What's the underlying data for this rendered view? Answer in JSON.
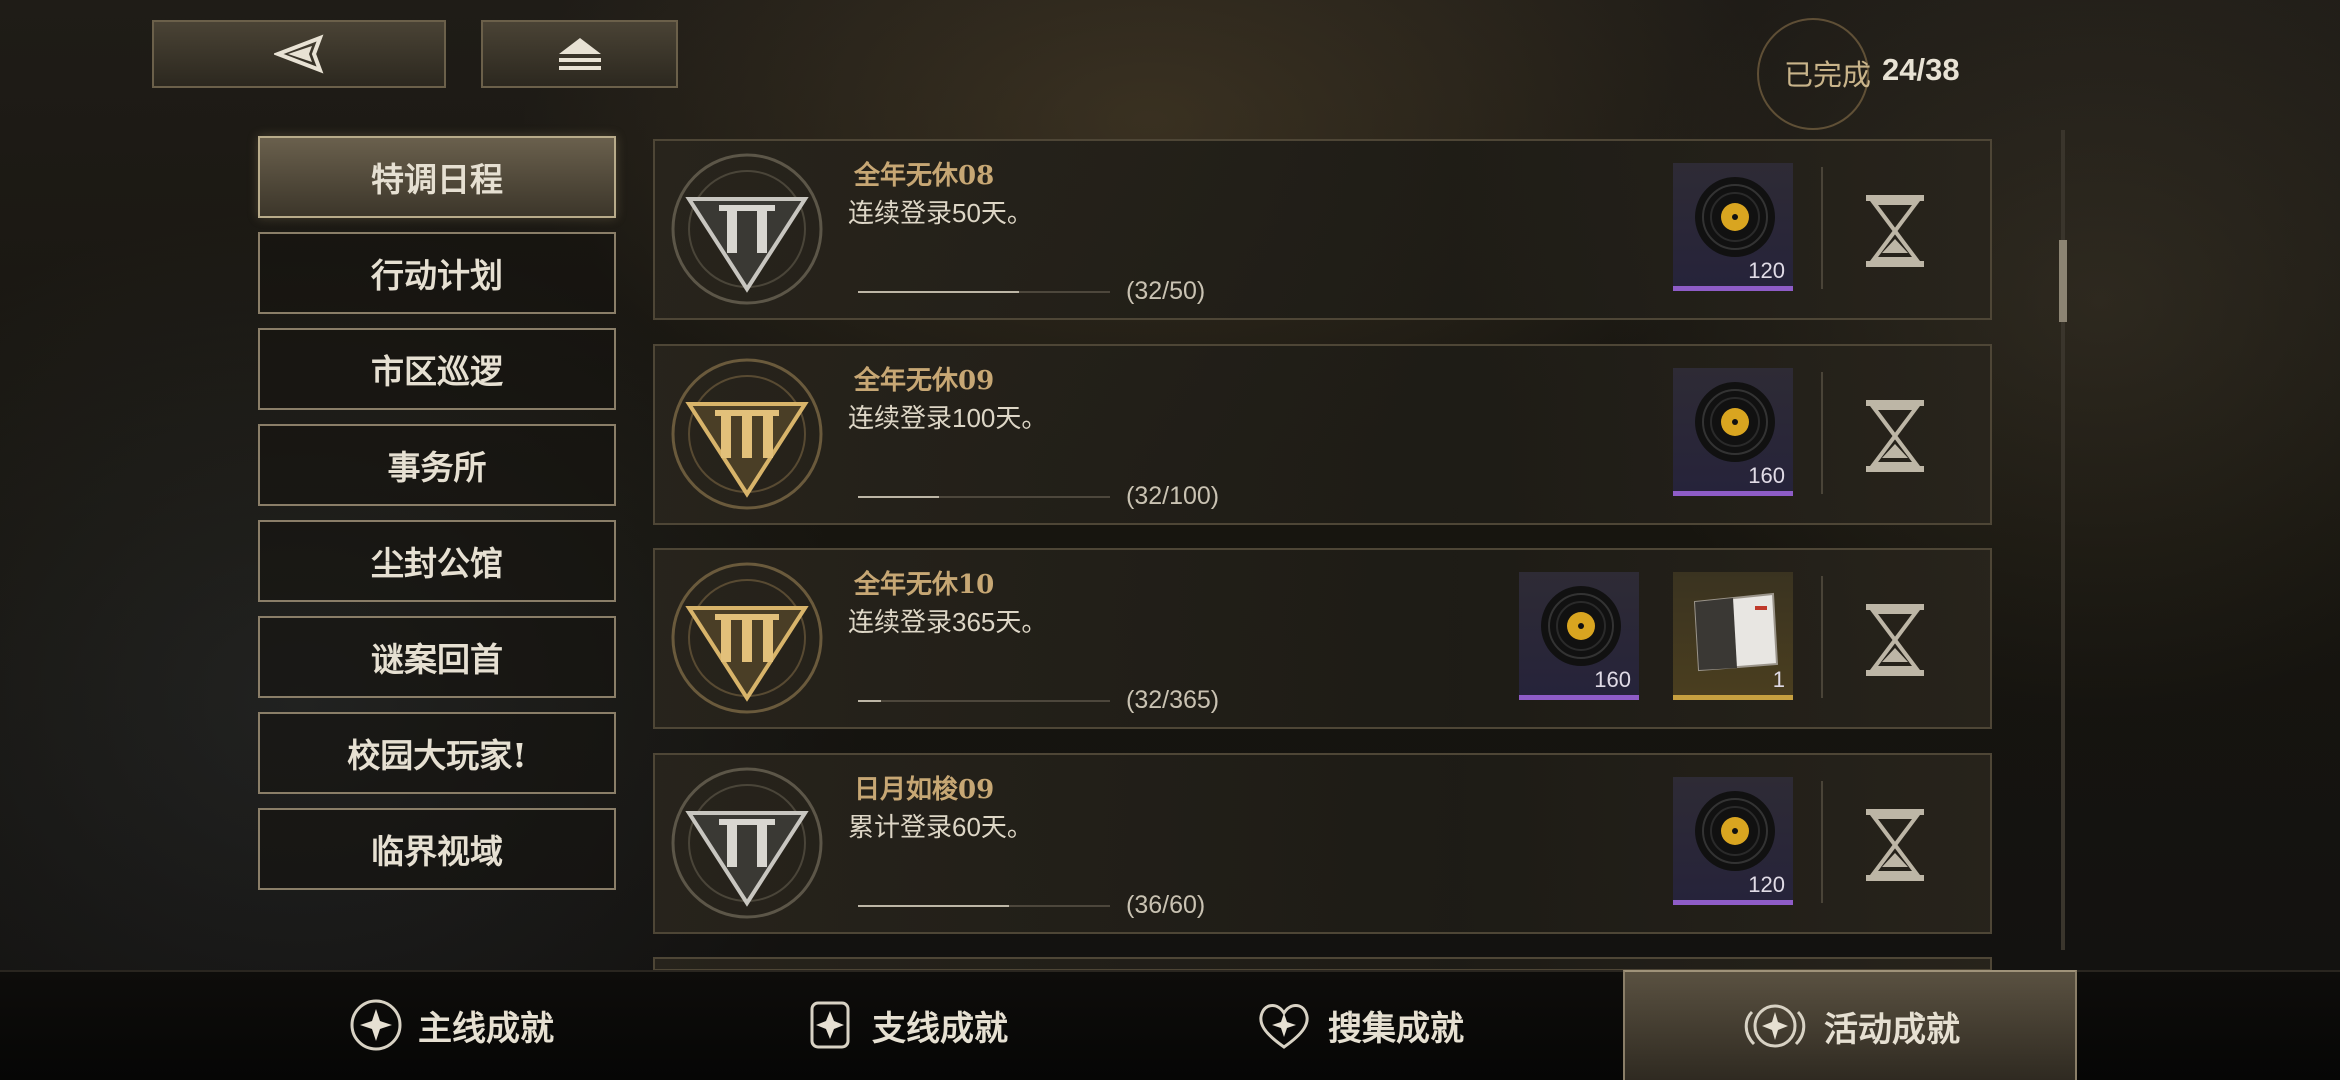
{
  "top": {
    "back_icon": "back-arrow-icon",
    "home_icon": "eject-home-icon",
    "completion_label": "已完成",
    "completion_count": "24/38"
  },
  "sidebar": {
    "items": [
      {
        "label": "特调日程",
        "active": true
      },
      {
        "label": "行动计划",
        "active": false
      },
      {
        "label": "市区巡逻",
        "active": false
      },
      {
        "label": "事务所",
        "active": false
      },
      {
        "label": "尘封公馆",
        "active": false
      },
      {
        "label": "谜案回首",
        "active": false
      },
      {
        "label": "校园大玩家!",
        "active": false
      },
      {
        "label": "临界视域",
        "active": false
      }
    ]
  },
  "achievements": [
    {
      "tier": "II",
      "title": "全年无休08",
      "desc": "连续登录50天。",
      "progress": "(32/50)",
      "fraction": 0.64,
      "rewards": [
        {
          "icon": "vinyl-record-icon",
          "amount": "120",
          "rarity": "purple"
        }
      ]
    },
    {
      "tier": "III",
      "title": "全年无休09",
      "desc": "连续登录100天。",
      "progress": "(32/100)",
      "fraction": 0.32,
      "rewards": [
        {
          "icon": "vinyl-record-icon",
          "amount": "160",
          "rarity": "purple"
        }
      ]
    },
    {
      "tier": "III",
      "title": "全年无休10",
      "desc": "连续登录365天。",
      "progress": "(32/365)",
      "fraction": 0.09,
      "rewards": [
        {
          "icon": "vinyl-record-icon",
          "amount": "160",
          "rarity": "purple"
        },
        {
          "icon": "card-item-icon",
          "amount": "1",
          "rarity": "gold"
        }
      ]
    },
    {
      "tier": "II",
      "title": "日月如梭09",
      "desc": "累计登录60天。",
      "progress": "(36/60)",
      "fraction": 0.6,
      "rewards": [
        {
          "icon": "vinyl-record-icon",
          "amount": "120",
          "rarity": "purple"
        }
      ]
    }
  ],
  "tabs": [
    {
      "label": "主线成就",
      "icon": "main-achievement-icon",
      "active": false
    },
    {
      "label": "支线成就",
      "icon": "side-achievement-icon",
      "active": false
    },
    {
      "label": "搜集成就",
      "icon": "collection-achievement-icon",
      "active": false
    },
    {
      "label": "活动成就",
      "icon": "event-achievement-icon",
      "active": true
    }
  ],
  "colors": {
    "accent_gold": "#c7a774",
    "rarity_purple": "#8e5cc7",
    "rarity_gold": "#c7a040"
  }
}
